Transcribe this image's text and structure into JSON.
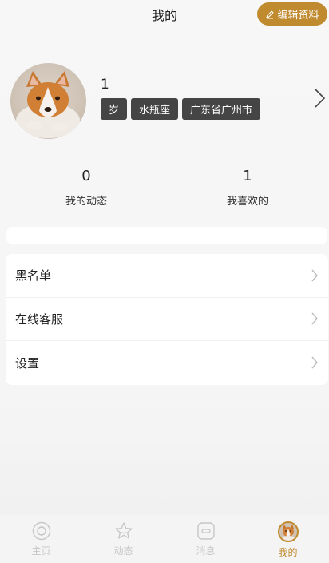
{
  "header": {
    "title": "我的",
    "edit_button_label": "编辑资料"
  },
  "profile": {
    "name": "1",
    "tags": [
      "岁",
      "水瓶座",
      "广东省广州市"
    ]
  },
  "stats": [
    {
      "value": "0",
      "label": "我的动态"
    },
    {
      "value": "1",
      "label": "我喜欢的"
    }
  ],
  "menu": {
    "items": [
      {
        "label": "黑名单"
      },
      {
        "label": "在线客服"
      },
      {
        "label": "设置"
      }
    ]
  },
  "tabbar": {
    "tabs": [
      {
        "label": "主页",
        "icon": "home-icon"
      },
      {
        "label": "动态",
        "icon": "star-icon"
      },
      {
        "label": "消息",
        "icon": "message-icon"
      },
      {
        "label": "我的",
        "icon": "avatar-icon",
        "active": true
      }
    ]
  },
  "colors": {
    "accent": "#c08a2e",
    "tag_bg": "#454545",
    "inactive_tab": "#c6c6c6"
  }
}
